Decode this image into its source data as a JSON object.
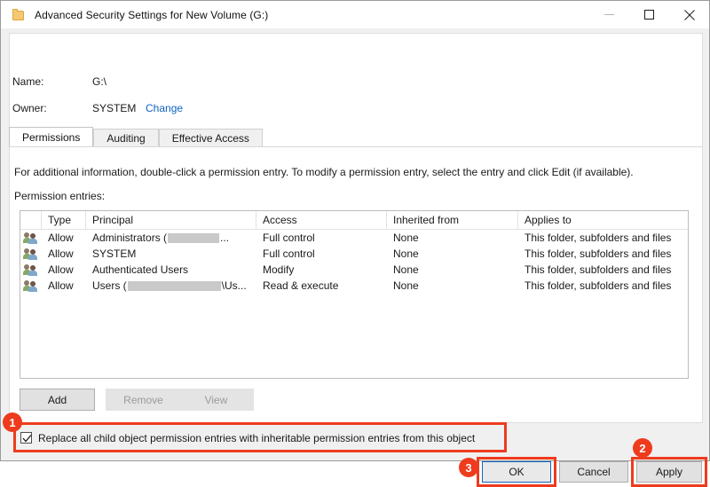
{
  "window": {
    "title": "Advanced Security Settings for New Volume (G:)",
    "icon": "folder-icon",
    "controls": {
      "minimize": "minimize-icon",
      "maximize": "maximize-icon",
      "close": "close-icon"
    }
  },
  "properties": {
    "name_label": "Name:",
    "name_value": "G:\\",
    "owner_label": "Owner:",
    "owner_value": "SYSTEM",
    "owner_change_link": "Change"
  },
  "tabs": [
    {
      "label": "Permissions",
      "active": true
    },
    {
      "label": "Auditing",
      "active": false
    },
    {
      "label": "Effective Access",
      "active": false
    }
  ],
  "main": {
    "info_text": "For additional information, double-click a permission entry. To modify a permission entry, select the entry and click Edit (if available).",
    "entries_label": "Permission entries:"
  },
  "table": {
    "columns": [
      "",
      "Type",
      "Principal",
      "Access",
      "Inherited from",
      "Applies to"
    ],
    "rows": [
      {
        "icon": "user-group-icon",
        "type": "Allow",
        "principal_prefix": "Administrators (",
        "principal_redacted": true,
        "principal_suffix": "...",
        "access": "Full control",
        "inherited_from": "None",
        "applies_to": "This folder, subfolders and files"
      },
      {
        "icon": "user-group-icon",
        "type": "Allow",
        "principal_prefix": "SYSTEM",
        "principal_redacted": false,
        "principal_suffix": "",
        "access": "Full control",
        "inherited_from": "None",
        "applies_to": "This folder, subfolders and files"
      },
      {
        "icon": "user-group-icon",
        "type": "Allow",
        "principal_prefix": "Authenticated Users",
        "principal_redacted": false,
        "principal_suffix": "",
        "access": "Modify",
        "inherited_from": "None",
        "applies_to": "This folder, subfolders and files"
      },
      {
        "icon": "user-group-icon",
        "type": "Allow",
        "principal_prefix": "Users (",
        "principal_redacted": true,
        "principal_suffix": "\\Us...",
        "access": "Read & execute",
        "inherited_from": "None",
        "applies_to": "This folder, subfolders and files"
      }
    ]
  },
  "list_buttons": {
    "add": "Add",
    "remove": "Remove",
    "view": "View"
  },
  "replace_option": {
    "label": "Replace all child object permission entries with inheritable permission entries from this object",
    "checked": true
  },
  "dialog_buttons": {
    "ok": "OK",
    "cancel": "Cancel",
    "apply": "Apply"
  },
  "annotations": {
    "badge_1": "1",
    "badge_2": "2",
    "badge_3": "3",
    "highlight_color": "#ee3b1e"
  }
}
